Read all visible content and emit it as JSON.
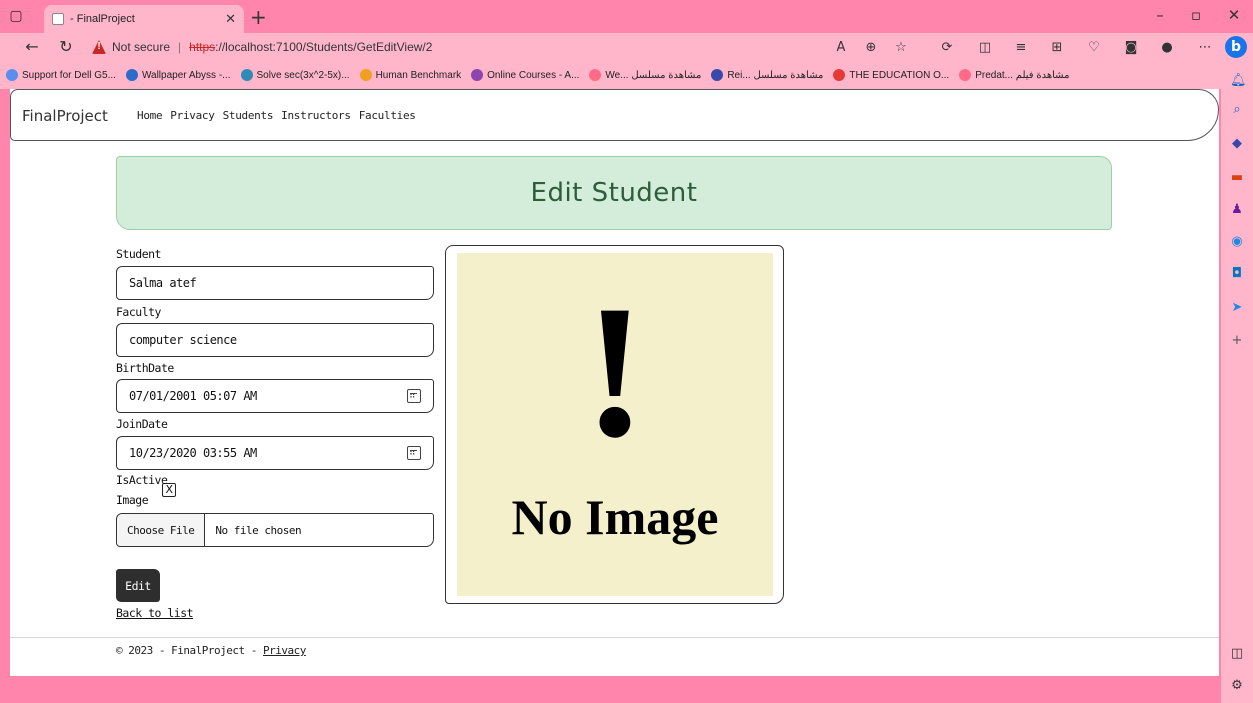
{
  "browser": {
    "tab_title": "- FinalProject",
    "address_security": "Not secure",
    "address_https": "https",
    "address_rest": "://localhost:7100/Students/GetEditView/2",
    "bing_label": "b"
  },
  "favorites": [
    {
      "label": "Support for Dell G5...",
      "color": "#5b8def"
    },
    {
      "label": "Wallpaper Abyss -...",
      "color": "#2d6bc9"
    },
    {
      "label": "Solve sec(3x^2-5x)...",
      "color": "#2e8bb7"
    },
    {
      "label": "Human Benchmark",
      "color": "#f0a020"
    },
    {
      "label": "Online Courses - A...",
      "color": "#8e44ad"
    },
    {
      "label": "We... مشاهدة مسلسل",
      "color": "#ff6a88"
    },
    {
      "label": "Rei... مشاهدة مسلسل",
      "color": "#3949ab"
    },
    {
      "label": "THE EDUCATION O...",
      "color": "#e53935"
    },
    {
      "label": "Predat... مشاهدة فيلم",
      "color": "#ff6a88"
    }
  ],
  "site": {
    "brand": "FinalProject",
    "nav": [
      "Home",
      "Privacy",
      "Students",
      "Instructors",
      "Faculties"
    ]
  },
  "page": {
    "heading": "Edit Student",
    "student_label": "Student",
    "student_value": "Salma atef",
    "faculty_label": "Faculty",
    "faculty_value": "computer science",
    "birthdate_label": "BirthDate",
    "birthdate_value": "07/01/2001 05:07 AM",
    "joindate_label": "JoinDate",
    "joindate_value": "10/23/2020 03:55 AM",
    "isactive_label": "IsActive",
    "isactive_mark": "X",
    "image_label": "Image",
    "choose_file": "Choose File",
    "no_file": "No file chosen",
    "edit_button": "Edit",
    "back_link": "Back to list",
    "no_image_text": "No Image",
    "no_image_glyph": "!"
  },
  "footer": {
    "text": "© 2023 - FinalProject - ",
    "privacy": "Privacy"
  }
}
